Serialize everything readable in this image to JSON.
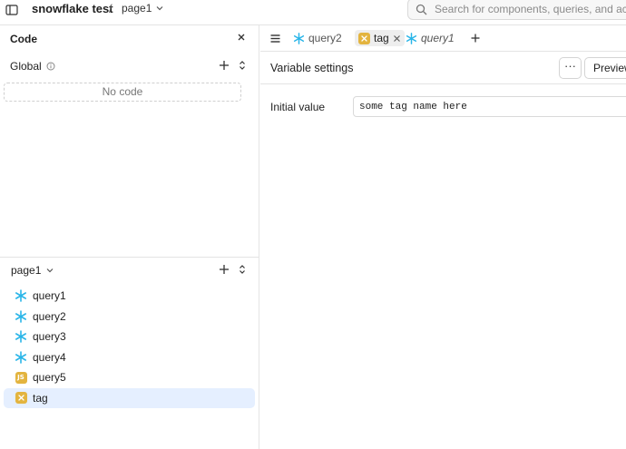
{
  "topbar": {
    "app_name": "snowflake test",
    "separator": "/",
    "page": "page1",
    "search_placeholder": "Search for components, queries, and actions"
  },
  "left_panel": {
    "header": "Code",
    "global_label": "Global",
    "no_code": "No code",
    "page_label": "page1",
    "queries": [
      {
        "name": "query1",
        "icon": "snowflake-icon"
      },
      {
        "name": "query2",
        "icon": "snowflake-icon"
      },
      {
        "name": "query3",
        "icon": "snowflake-icon"
      },
      {
        "name": "query4",
        "icon": "snowflake-icon"
      },
      {
        "name": "query5",
        "icon": "js-icon",
        "badge": "JS"
      },
      {
        "name": "tag",
        "icon": "variable-icon",
        "selected": true
      }
    ]
  },
  "tabs": [
    {
      "label": "query2",
      "icon": "snowflake-icon"
    },
    {
      "label": "tag",
      "icon": "variable-icon",
      "active": true
    },
    {
      "label": "query1",
      "icon": "snowflake-icon",
      "italic": true
    }
  ],
  "settings": {
    "title": "Variable settings",
    "more": "···",
    "preview": "Preview",
    "initial_value_label": "Initial value",
    "initial_value": "some tag name here"
  },
  "colors": {
    "snowflake": "#29b5e8",
    "badge": "#e3b43f",
    "selected_row": "#e5efff"
  }
}
